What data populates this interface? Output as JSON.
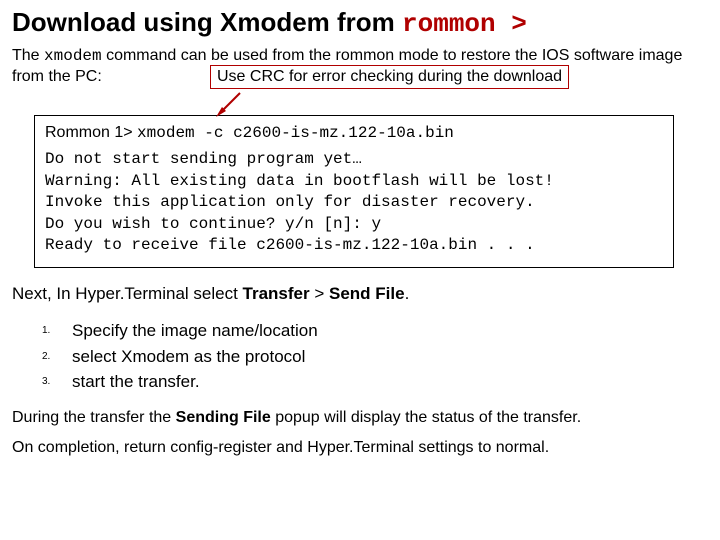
{
  "title": {
    "text_part": "Download using Xmodem from ",
    "mono_part": "rommon >"
  },
  "intro": {
    "pre": "The ",
    "cmd": "xmodem",
    "post": " command can be used from the rommon mode to restore the IOS software image from the PC:"
  },
  "callout": "Use CRC for error checking during the download",
  "terminal": {
    "prompt": "Rommon 1>",
    "command": "xmodem -c c2600-is-mz.122-10a.bin",
    "lines": [
      "Do not start sending program yet…",
      "Warning: All existing data in bootflash will be lost!",
      "Invoke this application only for disaster recovery.",
      "Do you wish to continue? y/n [n]: y",
      "Ready to receive file c2600-is-mz.122-10a.bin . . ."
    ]
  },
  "next_line": {
    "pre": "Next,  In Hyper.Terminal select ",
    "b1": "Transfer",
    "mid": " > ",
    "b2": "Send File",
    "post": "."
  },
  "steps": [
    "Specify the image name/location",
    "select Xmodem as the protocol",
    "start the transfer."
  ],
  "para1": {
    "pre": "During the transfer the ",
    "bold": "Sending File",
    "post": " popup will display the status of the transfer."
  },
  "para2": "On completion, return config-register and Hyper.Terminal settings to normal."
}
